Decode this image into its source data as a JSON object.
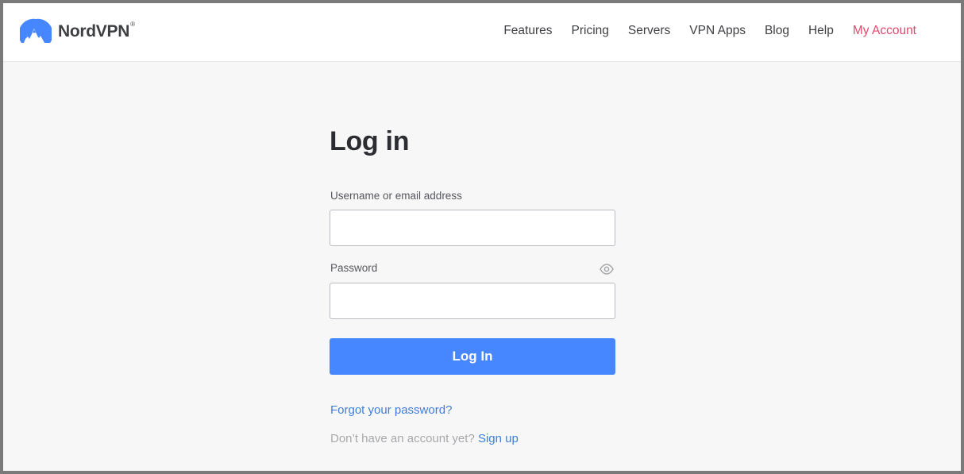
{
  "header": {
    "brand": "NordVPN",
    "brand_mark": "®",
    "logo_icon": "mountain-logo-icon",
    "nav": [
      {
        "label": "Features"
      },
      {
        "label": "Pricing"
      },
      {
        "label": "Servers"
      },
      {
        "label": "VPN Apps"
      },
      {
        "label": "Blog"
      },
      {
        "label": "Help"
      },
      {
        "label": "My Account"
      }
    ]
  },
  "login": {
    "title": "Log in",
    "username_label": "Username or email address",
    "username_value": "",
    "password_label": "Password",
    "password_value": "",
    "password_toggle_icon": "eye-icon",
    "submit_label": "Log In",
    "forgot_label": "Forgot your password?",
    "no_account_text": "Don’t have an account yet?",
    "signup_label": "Sign up"
  },
  "colors": {
    "brand_blue": "#4687ff",
    "link_blue": "#3f7fd9",
    "account_pink": "#e0486c",
    "text_dark": "#3e3f42",
    "page_bg": "#f7f7f7"
  }
}
